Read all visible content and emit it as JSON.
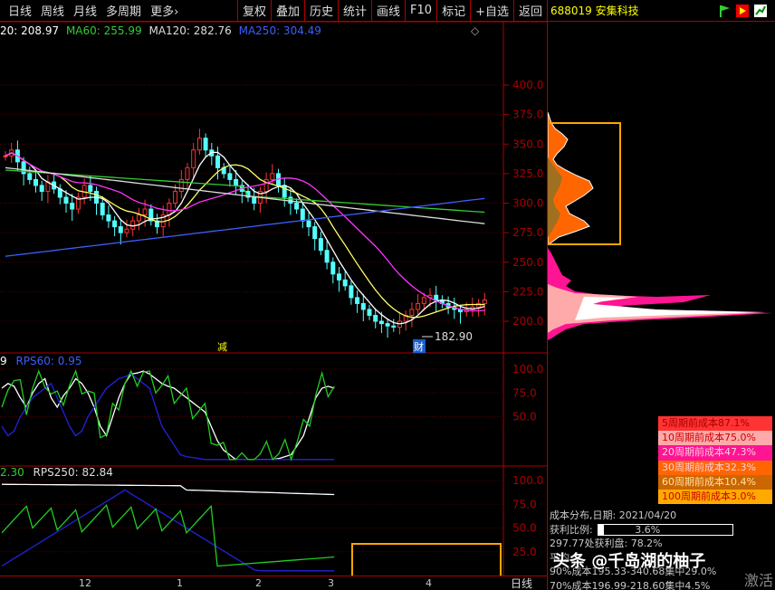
{
  "toolbar": {
    "left": [
      "日线",
      "周线",
      "月线",
      "多周期",
      "更多›"
    ],
    "right": [
      "复权",
      "叠加",
      "历史",
      "统计",
      "画线",
      "F10",
      "标记",
      "+自选",
      "返回"
    ]
  },
  "stock": {
    "code_name": "688019 安集科技"
  },
  "main_legend": {
    "ma_a": "20: 208.97",
    "ma60": "MA60: 255.99",
    "ma120": "MA120: 282.76",
    "ma250": "MA250: 304.49",
    "diamond": "◇"
  },
  "y_axis_main": [
    "400.0",
    "375.0",
    "350.0",
    "325.0",
    "300.0",
    "275.0",
    "250.0",
    "225.0",
    "200.0"
  ],
  "y_axis_rps60": [
    "100.0",
    "75.0",
    "50.0"
  ],
  "y_axis_rps250": [
    "100.0",
    "75.0",
    "50.0",
    "25.0"
  ],
  "annotations": {
    "low_price": "182.90",
    "reduce": "减",
    "finance": "财"
  },
  "rps60_legend": {
    "value_a": "9",
    "label": "RPS60: 0.95"
  },
  "rps250_legend": {
    "value_a": "2.30",
    "label": "RPS250: 82.84"
  },
  "x_axis": [
    "12",
    "1",
    "2",
    "3",
    "4"
  ],
  "period": "日线",
  "cost_legend": [
    {
      "label": "5周期前成本87.1%",
      "bg": "#ff3333"
    },
    {
      "label": "10周期前成本75.0%",
      "bg": "#ffaaaa"
    },
    {
      "label": "20周期前成本47.3%",
      "bg": "#ff1493"
    },
    {
      "label": "30周期前成本32.3%",
      "bg": "#ff6600"
    },
    {
      "label": "60周期前成本10.4%",
      "bg": "#cc6600"
    },
    {
      "label": "100周期前成本3.0%",
      "bg": "#ffaa00"
    }
  ],
  "stats": {
    "line1": "成本分布,日期: 2021/04/20",
    "line2_label": "获利比例:",
    "line2_value": "3.6%",
    "line3": "297.77处获利盘: 78.2%",
    "line4": "平均",
    "line5": "90%成本195.33-340.68集中29.0%",
    "line6": "70%成本196.99-218.60集中4.5%"
  },
  "watermark": {
    "text": "头条 @千岛湖的柚子",
    "activate": "激活"
  },
  "colors": {
    "grid": "#aa0000",
    "up": "#ff3333",
    "down": "#54ffff",
    "highlight": "#ffa500"
  }
}
